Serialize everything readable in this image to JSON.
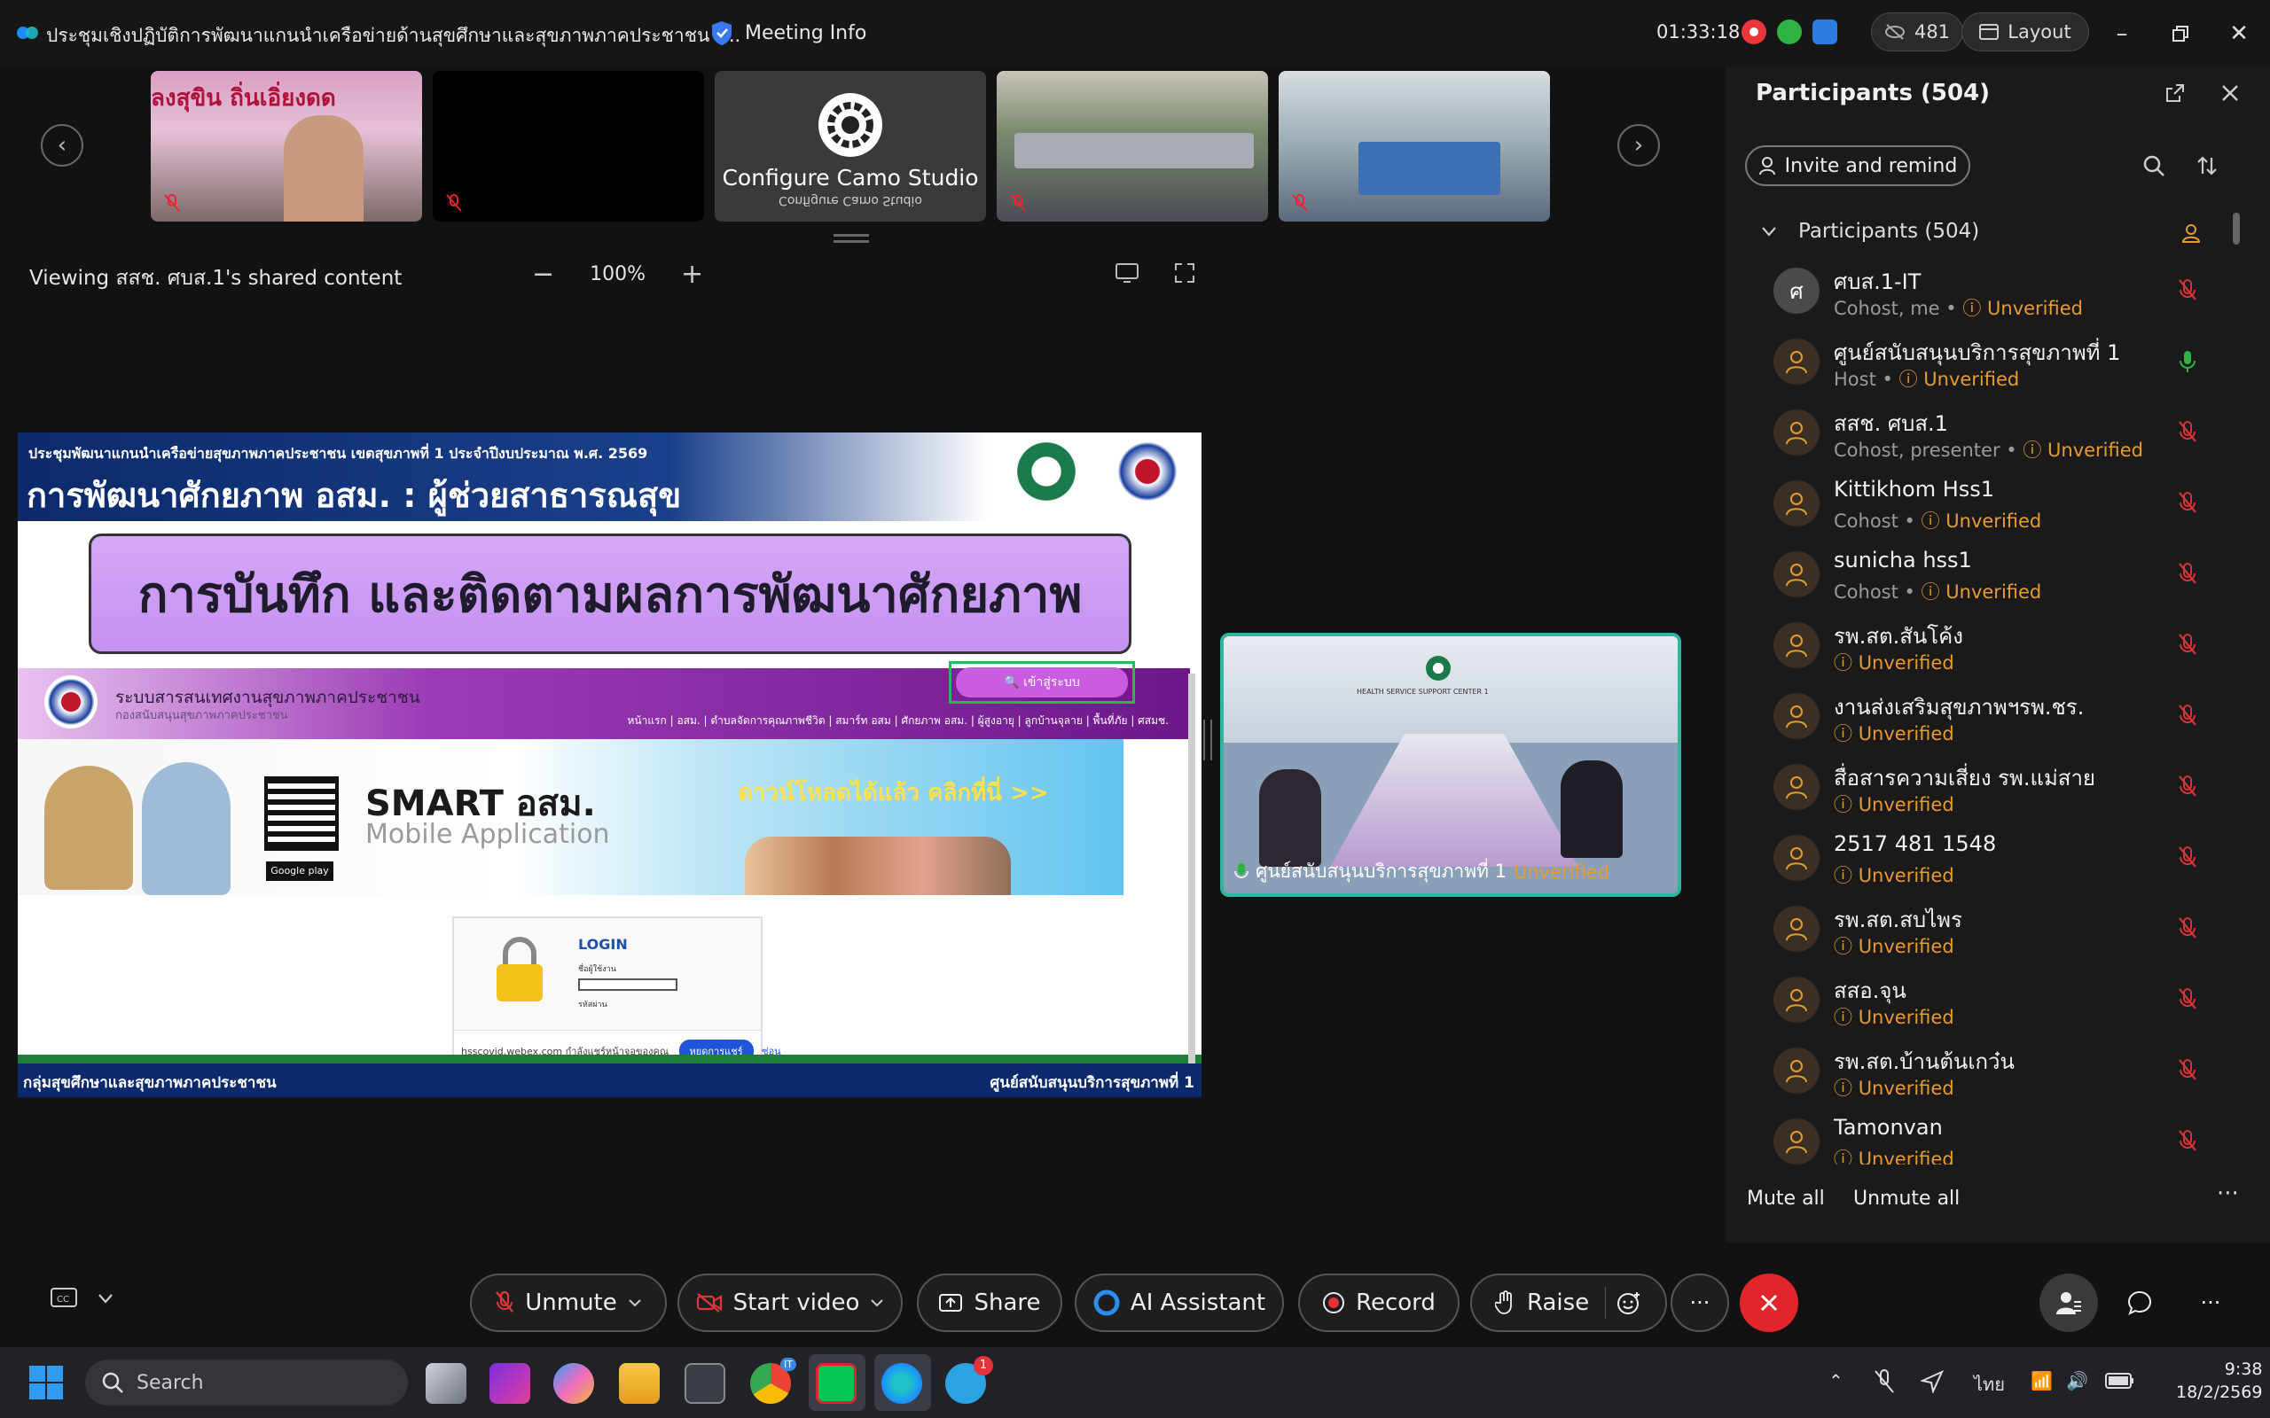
{
  "window": {
    "title": "ประชุมเชิงปฏิบัติการพัฒนาแกนนำเครือข่ายด้านสุขศึกษาและสุขภาพภาคประชาชน (...",
    "meeting_info": "Meeting Info",
    "elapsed": "01:33:18",
    "participant_count_pill": "481",
    "layout_label": "Layout"
  },
  "thumbnails": [
    {
      "name": "thumb-1",
      "label": ""
    },
    {
      "name": "thumb-2",
      "label": ""
    },
    {
      "name": "thumb-3",
      "label": "Configure Camo Studio",
      "mirror": "Configure Camo Studio"
    },
    {
      "name": "thumb-4",
      "label": ""
    },
    {
      "name": "thumb-5",
      "label": ""
    }
  ],
  "content_bar": {
    "viewing": "Viewing สสช. ศบส.1's shared content",
    "zoom": "100%",
    "zoom_out": "−",
    "zoom_in": "+"
  },
  "shared": {
    "subheading": "ประชุมพัฒนาแกนนำเครือข่ายสุขภาพภาคประชาชน เขตสุขภาพที่ 1 ประจำปีงบประมาณ พ.ศ. 2569",
    "heading": "การพัฒนาศักยภาพ อสม. : ผู้ช่วยสาธารณสุข",
    "banner": "การบันทึก และติดตามผลการพัฒนาศักยภาพ",
    "site_title": "ระบบสารสนเทศงานสุขภาพภาคประชาชน",
    "site_sub": "กองสนับสนุนสุขภาพภาคประชาชน",
    "site_menu": "หน้าแรก | อสม. | ตำบลจัดการคุณภาพชีวิต | สมาร์ท อสม | ศักยภาพ อสม. | ผู้สูงอายุ | ลูกบ้านจุลาย | พื้นที่ภัย | ศสมช.",
    "enter_button": "🔍 เข้าสู่ระบบ",
    "smart_title": "SMART อสม.",
    "smart_sub": "Mobile Application",
    "smart_cta": "ดาวน์โหลดได้แล้ว คลิกที่นี่ >>",
    "google_play": "Google play",
    "login_label": "LOGIN",
    "login_user": "ชื่อผู้ใช้งาน",
    "login_pass": "รหัสผ่าน",
    "login_bar_text": "hsscovid.webex.com กำลังแชร์หน้าจอของคุณ",
    "login_bar_button": "หยุดการแชร์",
    "login_bar_hide": "ซ่อน",
    "footer_left": "กลุ่มสุขศึกษาและสุขภาพภาคประชาชน",
    "footer_right": "ศูนย์สนับสนุนบริการสุขภาพที่ 1"
  },
  "speaker": {
    "name": "ศูนย์สนับสนุนบริการสุขภาพที่ 1",
    "status": "Unverified",
    "wall_text": "HEALTH SERVICE SUPPORT CENTER 1"
  },
  "panel": {
    "title": "Participants (504)",
    "invite": "Invite and remind",
    "group": "Participants (504)",
    "participants": [
      {
        "avatar": "ศ",
        "name": "ศบส.1-IT",
        "role": "Cohost, me",
        "status": "Unverified",
        "mic": "muted"
      },
      {
        "avatar": "",
        "name": "ศูนย์สนับสนุนบริการสุขภาพที่ 1",
        "role": "Host",
        "status": "Unverified",
        "mic": "on"
      },
      {
        "avatar": "",
        "name": "สสช. ศบส.1",
        "role": "Cohost, presenter",
        "status": "Unverified",
        "mic": "muted"
      },
      {
        "avatar": "",
        "name": "Kittikhom Hss1",
        "role": "Cohost",
        "status": "Unverified",
        "mic": "muted"
      },
      {
        "avatar": "",
        "name": "sunicha hss1",
        "role": "Cohost",
        "status": "Unverified",
        "mic": "muted"
      },
      {
        "avatar": "",
        "name": "รพ.สต.สันโค้ง",
        "role": "",
        "status": "Unverified",
        "mic": "muted"
      },
      {
        "avatar": "",
        "name": "งานส่งเสริมสุขภาพฯรพ.ชร.",
        "role": "",
        "status": "Unverified",
        "mic": "muted"
      },
      {
        "avatar": "",
        "name": "สื่อสารความเสี่ยง รพ.แม่สาย",
        "role": "",
        "status": "Unverified",
        "mic": "muted"
      },
      {
        "avatar": "",
        "name": "2517 481 1548",
        "role": "",
        "status": "Unverified",
        "mic": "muted"
      },
      {
        "avatar": "",
        "name": "รพ.สต.สบไพร",
        "role": "",
        "status": "Unverified",
        "mic": "muted"
      },
      {
        "avatar": "",
        "name": "สสอ.จุน",
        "role": "",
        "status": "Unverified",
        "mic": "muted"
      },
      {
        "avatar": "",
        "name": "รพ.สต.บ้านต้นเกว๋น",
        "role": "",
        "status": "Unverified",
        "mic": "muted"
      },
      {
        "avatar": "",
        "name": "Tamonvan",
        "role": "",
        "status": "Unverified",
        "mic": "muted"
      }
    ],
    "mute_all": "Mute all",
    "unmute_all": "Unmute all"
  },
  "controls": {
    "unmute": "Unmute",
    "start_video": "Start video",
    "share": "Share",
    "ai_assistant": "AI Assistant",
    "record": "Record",
    "raise": "Raise"
  },
  "taskbar": {
    "search": "Search",
    "lang": "ไทย",
    "time": "9:38",
    "date": "18/2/2569",
    "telegram_badge": "1",
    "chrome_badge": "IT"
  },
  "colors": {
    "accent_unverified": "#e59b34",
    "leave_red": "#e0262b",
    "speaker_border": "#2fb5a0",
    "muted_red": "#d8323a"
  }
}
